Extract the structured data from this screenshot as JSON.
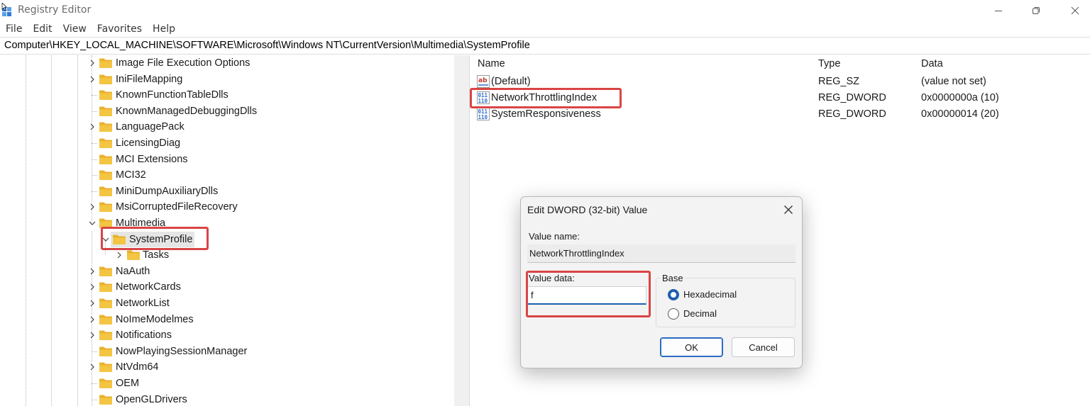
{
  "window": {
    "title": "Registry Editor",
    "icons": {
      "app": "registry-editor-icon",
      "minimize": "minimize-icon",
      "maximize": "maximize-icon",
      "close": "close-icon"
    }
  },
  "menu": {
    "items": [
      {
        "label": "File"
      },
      {
        "label": "Edit"
      },
      {
        "label": "View"
      },
      {
        "label": "Favorites"
      },
      {
        "label": "Help"
      }
    ]
  },
  "address": {
    "path": "Computer\\HKEY_LOCAL_MACHINE\\SOFTWARE\\Microsoft\\Windows NT\\CurrentVersion\\Multimedia\\SystemProfile"
  },
  "tree": {
    "items": [
      {
        "label": "Image File Execution Options",
        "expander": "collapsed"
      },
      {
        "label": "IniFileMapping",
        "expander": "collapsed"
      },
      {
        "label": "KnownFunctionTableDlls",
        "expander": "none"
      },
      {
        "label": "KnownManagedDebuggingDlls",
        "expander": "none"
      },
      {
        "label": "LanguagePack",
        "expander": "collapsed"
      },
      {
        "label": "LicensingDiag",
        "expander": "none"
      },
      {
        "label": "MCI Extensions",
        "expander": "none"
      },
      {
        "label": "MCI32",
        "expander": "none"
      },
      {
        "label": "MiniDumpAuxiliaryDlls",
        "expander": "none"
      },
      {
        "label": "MsiCorruptedFileRecovery",
        "expander": "collapsed"
      },
      {
        "label": "Multimedia",
        "expander": "expanded"
      },
      {
        "label": "SystemProfile",
        "expander": "expanded",
        "selected": true
      },
      {
        "label": "Tasks",
        "expander": "collapsed"
      },
      {
        "label": "NaAuth",
        "expander": "collapsed"
      },
      {
        "label": "NetworkCards",
        "expander": "collapsed"
      },
      {
        "label": "NetworkList",
        "expander": "collapsed"
      },
      {
        "label": "NoImeModelmes",
        "expander": "collapsed"
      },
      {
        "label": "Notifications",
        "expander": "collapsed"
      },
      {
        "label": "NowPlayingSessionManager",
        "expander": "none"
      },
      {
        "label": "NtVdm64",
        "expander": "collapsed"
      },
      {
        "label": "OEM",
        "expander": "none"
      },
      {
        "label": "OpenGLDrivers",
        "expander": "none"
      }
    ]
  },
  "values_pane": {
    "columns": {
      "name": "Name",
      "type": "Type",
      "data": "Data"
    },
    "rows": [
      {
        "icon": "string-value-icon",
        "name": "(Default)",
        "type": "REG_SZ",
        "data": "(value not set)"
      },
      {
        "icon": "binary-value-icon",
        "name": "NetworkThrottlingIndex",
        "type": "REG_DWORD",
        "data": "0x0000000a (10)"
      },
      {
        "icon": "binary-value-icon",
        "name": "SystemResponsiveness",
        "type": "REG_DWORD",
        "data": "0x00000014 (20)"
      }
    ]
  },
  "dialog": {
    "title": "Edit DWORD (32-bit) Value",
    "value_name_label": "Value name:",
    "value_name": "NetworkThrottlingIndex",
    "value_data_label": "Value data:",
    "value_data": "f",
    "base_label": "Base",
    "base_options": [
      {
        "label": "Hexadecimal",
        "selected": true
      },
      {
        "label": "Decimal",
        "selected": false
      }
    ],
    "ok_label": "OK",
    "cancel_label": "Cancel"
  },
  "colors": {
    "folder": "#f4c542",
    "highlight_box": "#d94545",
    "accent": "#1c5fb0",
    "selection": "#e5e5e5"
  }
}
